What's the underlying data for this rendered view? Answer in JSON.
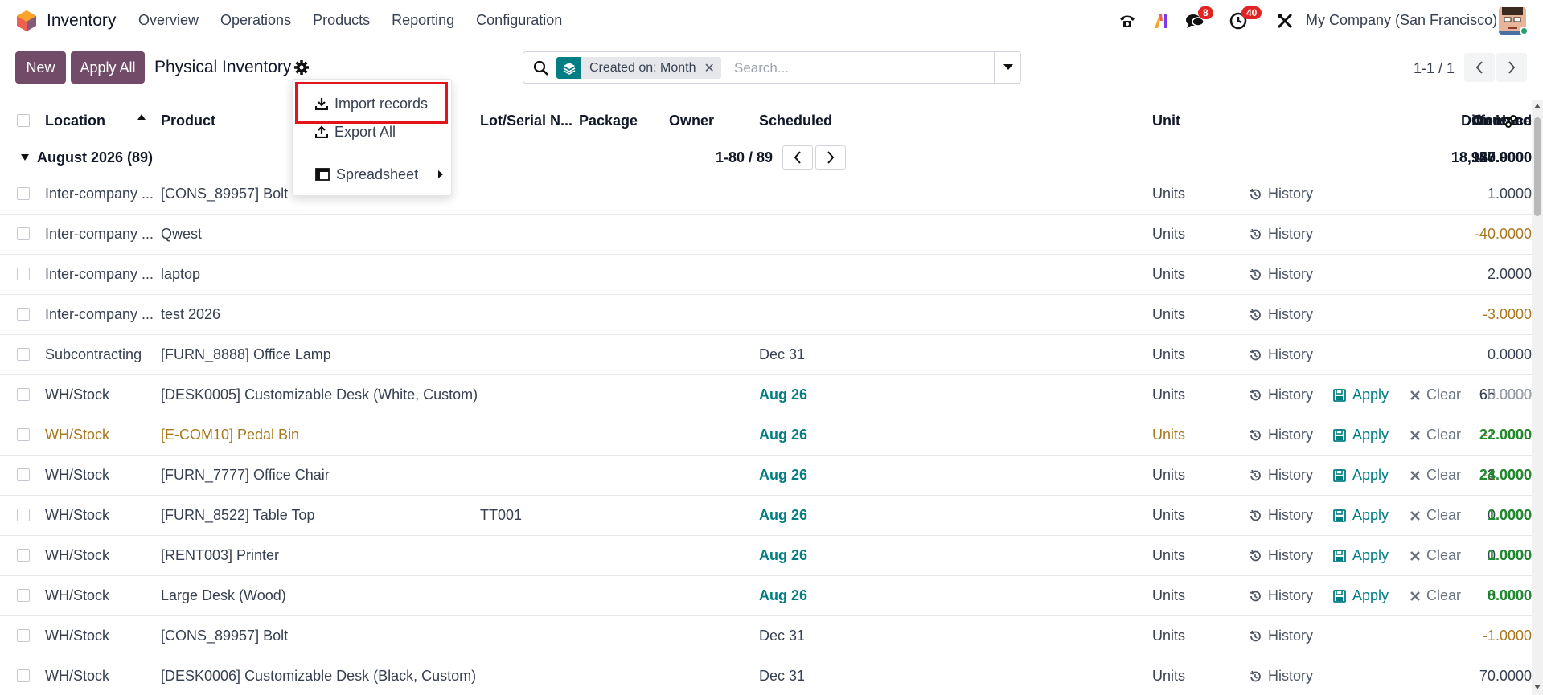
{
  "navbar": {
    "app_name": "Inventory",
    "menu": [
      "Overview",
      "Operations",
      "Products",
      "Reporting",
      "Configuration"
    ],
    "chat_badge": "8",
    "activity_badge": "40",
    "company": "My Company (San Francisco)"
  },
  "control_panel": {
    "new_label": "New",
    "apply_all_label": "Apply All",
    "title": "Physical Inventory",
    "search": {
      "facet_label": "Created on: Month",
      "facet_close": "✕",
      "placeholder": "Search..."
    },
    "pager": "1-1 / 1"
  },
  "dropdown": {
    "items": [
      "Import records",
      "Export All",
      "Spreadsheet"
    ]
  },
  "table": {
    "columns": {
      "location": "Location",
      "product": "Product",
      "lot": "Lot/Serial N...",
      "package": "Package",
      "owner": "Owner",
      "scheduled": "Scheduled",
      "on_hand": "On Hand",
      "counted": "Counted",
      "difference": "Difference",
      "unit": "Unit"
    },
    "group": {
      "label": "August 2026 (89)",
      "pager": "1-80 / 89",
      "on_hand": "18,947.9000",
      "counted": "120.0000",
      "difference": "56.0000"
    },
    "action_labels": {
      "history": "History",
      "apply": "Apply",
      "clear": "Clear"
    },
    "rows": [
      {
        "location": "Inter-company ...",
        "product": "[CONS_89957] Bolt",
        "lot": "",
        "scheduled": "",
        "on_hand": "1.0000",
        "counted": "",
        "difference": "",
        "unit": "Units"
      },
      {
        "location": "Inter-company ...",
        "product": "Qwest",
        "lot": "",
        "scheduled": "",
        "on_hand": "-40.0000",
        "counted": "",
        "difference": "",
        "unit": "Units"
      },
      {
        "location": "Inter-company ...",
        "product": "laptop",
        "lot": "",
        "scheduled": "",
        "on_hand": "2.0000",
        "counted": "",
        "difference": "",
        "unit": "Units"
      },
      {
        "location": "Inter-company ...",
        "product": "test 2026",
        "lot": "",
        "scheduled": "",
        "on_hand": "-3.0000",
        "counted": "",
        "difference": "",
        "unit": "Units"
      },
      {
        "location": "Subcontracting",
        "product": "[FURN_8888] Office Lamp",
        "lot": "",
        "scheduled": "Dec 31",
        "on_hand": "0.0000",
        "counted": "",
        "difference": "",
        "unit": "Units"
      },
      {
        "location": "WH/Stock",
        "product": "[DESK0005] Customizable Desk (White, Custom)",
        "lot": "",
        "scheduled": "Aug 26",
        "on_hand": "65.0000",
        "counted": "65.0000",
        "difference": "0.0000",
        "unit": "Units"
      },
      {
        "location": "WH/Stock",
        "product": "[E-COM10] Pedal Bin",
        "lot": "",
        "scheduled": "Aug 26",
        "on_hand": "-1.0000",
        "counted": "22.0000",
        "difference": "22.0000",
        "unit": "Units"
      },
      {
        "location": "WH/Stock",
        "product": "[FURN_7777] Office Chair",
        "lot": "",
        "scheduled": "Aug 26",
        "on_hand": "-1.0000",
        "counted": "23.0000",
        "difference": "24.0000",
        "unit": "Units"
      },
      {
        "location": "WH/Stock",
        "product": "[FURN_8522] Table Top",
        "lot": "TT001",
        "scheduled": "Aug 26",
        "on_hand": "0.0000",
        "counted": "1.0000",
        "difference": "1.0000",
        "unit": "Units"
      },
      {
        "location": "WH/Stock",
        "product": "[RENT003] Printer",
        "lot": "",
        "scheduled": "Aug 26",
        "on_hand": "0.0000",
        "counted": "1.0000",
        "difference": "1.0000",
        "unit": "Units"
      },
      {
        "location": "WH/Stock",
        "product": "Large Desk (Wood)",
        "lot": "",
        "scheduled": "Aug 26",
        "on_hand": "0.0000",
        "counted": "8.0000",
        "difference": "8.0000",
        "unit": "Units"
      },
      {
        "location": "WH/Stock",
        "product": "[CONS_89957] Bolt",
        "lot": "",
        "scheduled": "Dec 31",
        "on_hand": "-1.0000",
        "counted": "",
        "difference": "",
        "unit": "Units"
      },
      {
        "location": "WH/Stock",
        "product": "[DESK0006] Customizable Desk (Black, Custom)",
        "lot": "",
        "scheduled": "Dec 31",
        "on_hand": "70.0000",
        "counted": "",
        "difference": "",
        "unit": "Units"
      }
    ]
  },
  "colors": {
    "brand": "#714b67",
    "teal": "#017e84",
    "warning": "#a8781f",
    "success": "#1f8a2f",
    "highlight": "#e3141b"
  }
}
